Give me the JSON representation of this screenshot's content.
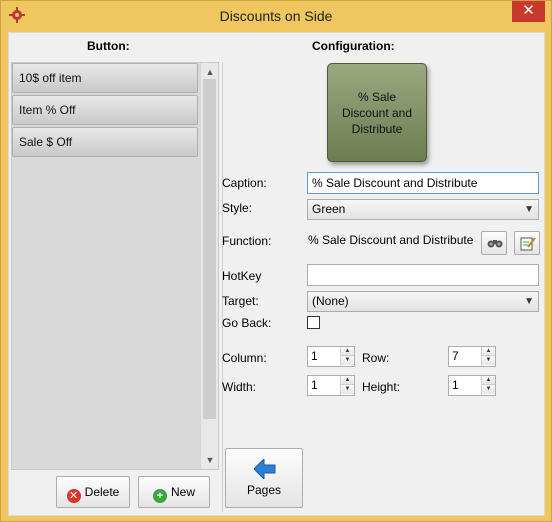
{
  "window": {
    "title": "Discounts on Side",
    "close_glyph": "✕",
    "app_icon": "gear-icon"
  },
  "left": {
    "header": "Button:",
    "items": [
      {
        "label": "10$ off item"
      },
      {
        "label": "Item % Off"
      },
      {
        "label": "Sale $ Off"
      }
    ],
    "delete_label": "Delete",
    "new_label": "New"
  },
  "right": {
    "header": "Configuration:",
    "preview_label": "% Sale Discount and Distribute",
    "caption_label": "Caption:",
    "caption_value": "% Sale Discount and Distribute",
    "style_label": "Style:",
    "style_value": "Green",
    "function_label": "Function:",
    "function_value": "% Sale Discount and Distribute",
    "hotkey_label": "HotKey",
    "hotkey_value": "",
    "target_label": "Target:",
    "target_value": "(None)",
    "goback_label": "Go Back:",
    "goback_checked": false,
    "column_label": "Column:",
    "column_value": "1",
    "row_label": "Row:",
    "row_value": "7",
    "width_label": "Width:",
    "width_value": "1",
    "height_label": "Height:",
    "height_value": "1",
    "pages_label": "Pages"
  },
  "colors": {
    "title_bar": "#f0c75e",
    "close_button": "#c7392c",
    "preview_button": "#7d8c62",
    "delete_icon": "#d9342b",
    "new_icon": "#3aa53a",
    "pages_arrow": "#2b7fd6"
  }
}
